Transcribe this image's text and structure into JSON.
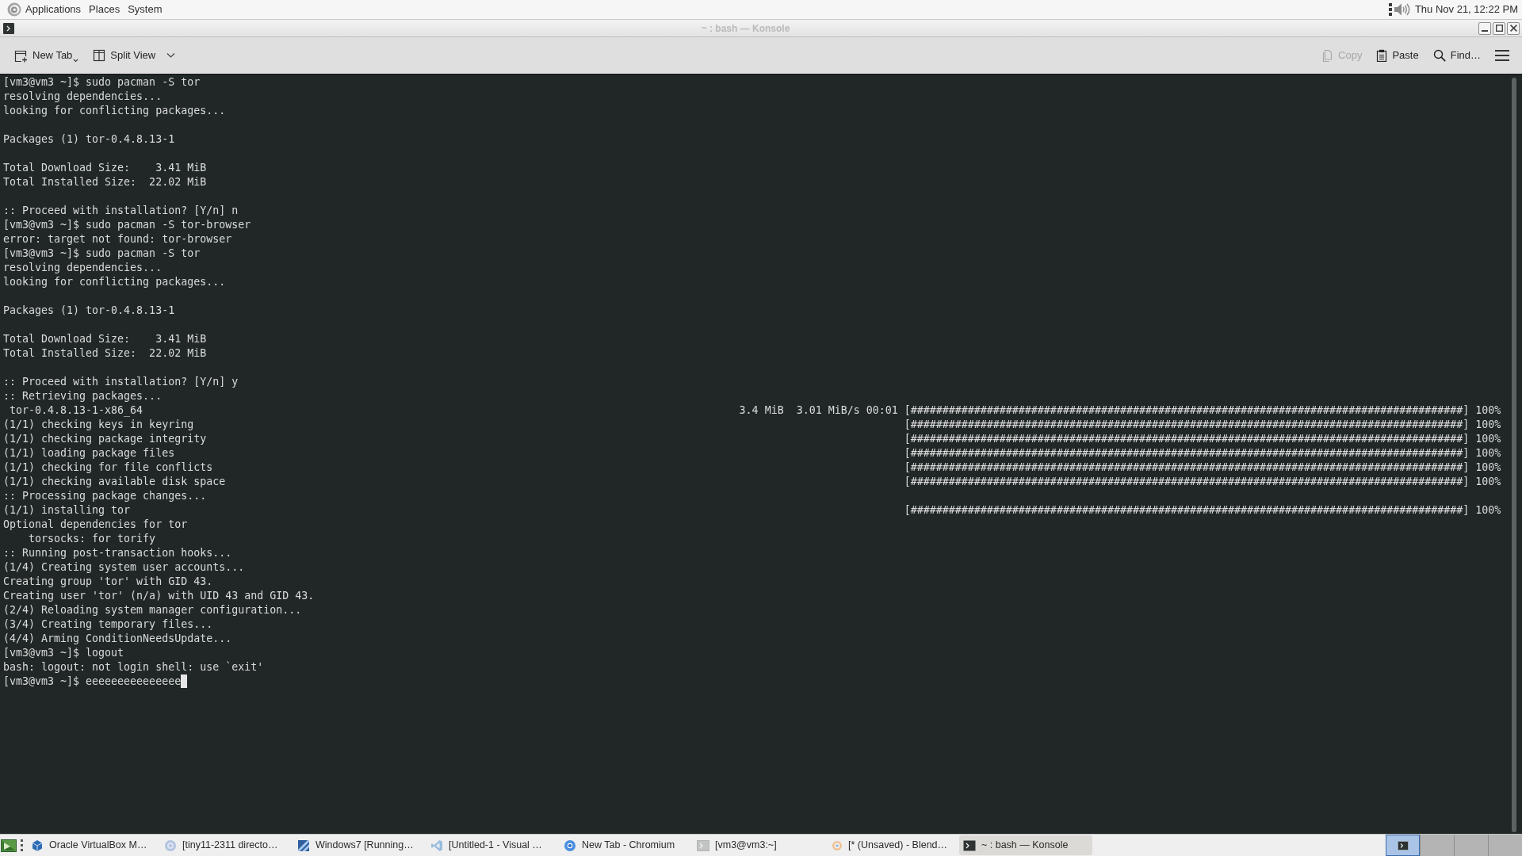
{
  "top_panel": {
    "menus": [
      "Applications",
      "Places",
      "System"
    ],
    "clock": "Thu Nov 21, 12:22 PM"
  },
  "window": {
    "title": "~ : bash — Konsole"
  },
  "toolbar": {
    "left": [
      {
        "kind": "new-tab",
        "label": "New Tab",
        "disabled": false
      },
      {
        "kind": "split-view",
        "label": "Split View",
        "disabled": false
      }
    ],
    "right": [
      {
        "kind": "copy",
        "label": "Copy",
        "disabled": true
      },
      {
        "kind": "paste",
        "label": "Paste",
        "disabled": false
      },
      {
        "kind": "find",
        "label": "Find…",
        "disabled": false
      }
    ]
  },
  "terminal": {
    "lines": [
      {
        "kind": "text",
        "text": "[vm3@vm3 ~]$ sudo pacman -S tor"
      },
      {
        "kind": "text",
        "text": "resolving dependencies..."
      },
      {
        "kind": "text",
        "text": "looking for conflicting packages..."
      },
      {
        "kind": "blank"
      },
      {
        "kind": "text",
        "text": "Packages (1) tor-0.4.8.13-1"
      },
      {
        "kind": "blank"
      },
      {
        "kind": "text",
        "text": "Total Download Size:    3.41 MiB"
      },
      {
        "kind": "text",
        "text": "Total Installed Size:  22.02 MiB"
      },
      {
        "kind": "blank"
      },
      {
        "kind": "text",
        "text": ":: Proceed with installation? [Y/n] n"
      },
      {
        "kind": "text",
        "text": "[vm3@vm3 ~]$ sudo pacman -S tor-browser"
      },
      {
        "kind": "text",
        "text": "error: target not found: tor-browser"
      },
      {
        "kind": "text",
        "text": "[vm3@vm3 ~]$ sudo pacman -S tor"
      },
      {
        "kind": "text",
        "text": "resolving dependencies..."
      },
      {
        "kind": "text",
        "text": "looking for conflicting packages..."
      },
      {
        "kind": "blank"
      },
      {
        "kind": "text",
        "text": "Packages (1) tor-0.4.8.13-1"
      },
      {
        "kind": "blank"
      },
      {
        "kind": "text",
        "text": "Total Download Size:    3.41 MiB"
      },
      {
        "kind": "text",
        "text": "Total Installed Size:  22.02 MiB"
      },
      {
        "kind": "blank"
      },
      {
        "kind": "text",
        "text": ":: Proceed with installation? [Y/n] y"
      },
      {
        "kind": "text",
        "text": ":: Retrieving packages..."
      },
      {
        "kind": "progress",
        "text": " tor-0.4.8.13-1-x86_64",
        "info": "3.4 MiB  3.01 MiB/s 00:01",
        "bar": "[#######################################################################################]",
        "percent": "100%"
      },
      {
        "kind": "progress",
        "text": "(1/1) checking keys in keyring",
        "bar": "[#######################################################################################]",
        "percent": "100%"
      },
      {
        "kind": "progress",
        "text": "(1/1) checking package integrity",
        "bar": "[#######################################################################################]",
        "percent": "100%"
      },
      {
        "kind": "progress",
        "text": "(1/1) loading package files",
        "bar": "[#######################################################################################]",
        "percent": "100%"
      },
      {
        "kind": "progress",
        "text": "(1/1) checking for file conflicts",
        "bar": "[#######################################################################################]",
        "percent": "100%"
      },
      {
        "kind": "progress",
        "text": "(1/1) checking available disk space",
        "bar": "[#######################################################################################]",
        "percent": "100%"
      },
      {
        "kind": "text",
        "text": ":: Processing package changes..."
      },
      {
        "kind": "progress",
        "text": "(1/1) installing tor",
        "bar": "[#######################################################################################]",
        "percent": "100%"
      },
      {
        "kind": "text",
        "text": "Optional dependencies for tor"
      },
      {
        "kind": "text",
        "text": "    torsocks: for torify"
      },
      {
        "kind": "text",
        "text": ":: Running post-transaction hooks..."
      },
      {
        "kind": "text",
        "text": "(1/4) Creating system user accounts..."
      },
      {
        "kind": "text",
        "text": "Creating group 'tor' with GID 43."
      },
      {
        "kind": "text",
        "text": "Creating user 'tor' (n/a) with UID 43 and GID 43."
      },
      {
        "kind": "text",
        "text": "(2/4) Reloading system manager configuration..."
      },
      {
        "kind": "text",
        "text": "(3/4) Creating temporary files..."
      },
      {
        "kind": "text",
        "text": "(4/4) Arming ConditionNeedsUpdate..."
      },
      {
        "kind": "text",
        "text": "[vm3@vm3 ~]$ logout"
      },
      {
        "kind": "text",
        "text": "bash: logout: not login shell: use `exit'"
      },
      {
        "kind": "input",
        "text": "[vm3@vm3 ~]$ eeeeeeeeeeeeeee"
      }
    ]
  },
  "taskbar": {
    "tasks": [
      {
        "kind": "virtualbox",
        "label": "Oracle VirtualBox M…",
        "minimized": false,
        "selected": false
      },
      {
        "kind": "globe",
        "label": "[tiny11-2311 directo…",
        "minimized": true,
        "selected": false
      },
      {
        "kind": "vm",
        "label": "Windows7 [Running…",
        "minimized": false,
        "selected": false
      },
      {
        "kind": "editor",
        "label": "[Untitled-1 - Visual …",
        "minimized": true,
        "selected": false
      },
      {
        "kind": "browser",
        "label": "New Tab - Chromium",
        "minimized": false,
        "selected": false
      },
      {
        "kind": "console",
        "label": "[vm3@vm3:~]",
        "minimized": true,
        "selected": false
      },
      {
        "kind": "blender",
        "label": "[* (Unsaved) - Blend…",
        "minimized": true,
        "selected": false
      },
      {
        "kind": "konsole",
        "label": "~ : bash — Konsole",
        "minimized": false,
        "selected": true
      }
    ],
    "workspaces": [
      {
        "selected": true,
        "windows": [
          {
            "kind": "terminal"
          }
        ]
      },
      {
        "selected": false
      },
      {
        "selected": false
      },
      {
        "selected": false
      }
    ]
  }
}
